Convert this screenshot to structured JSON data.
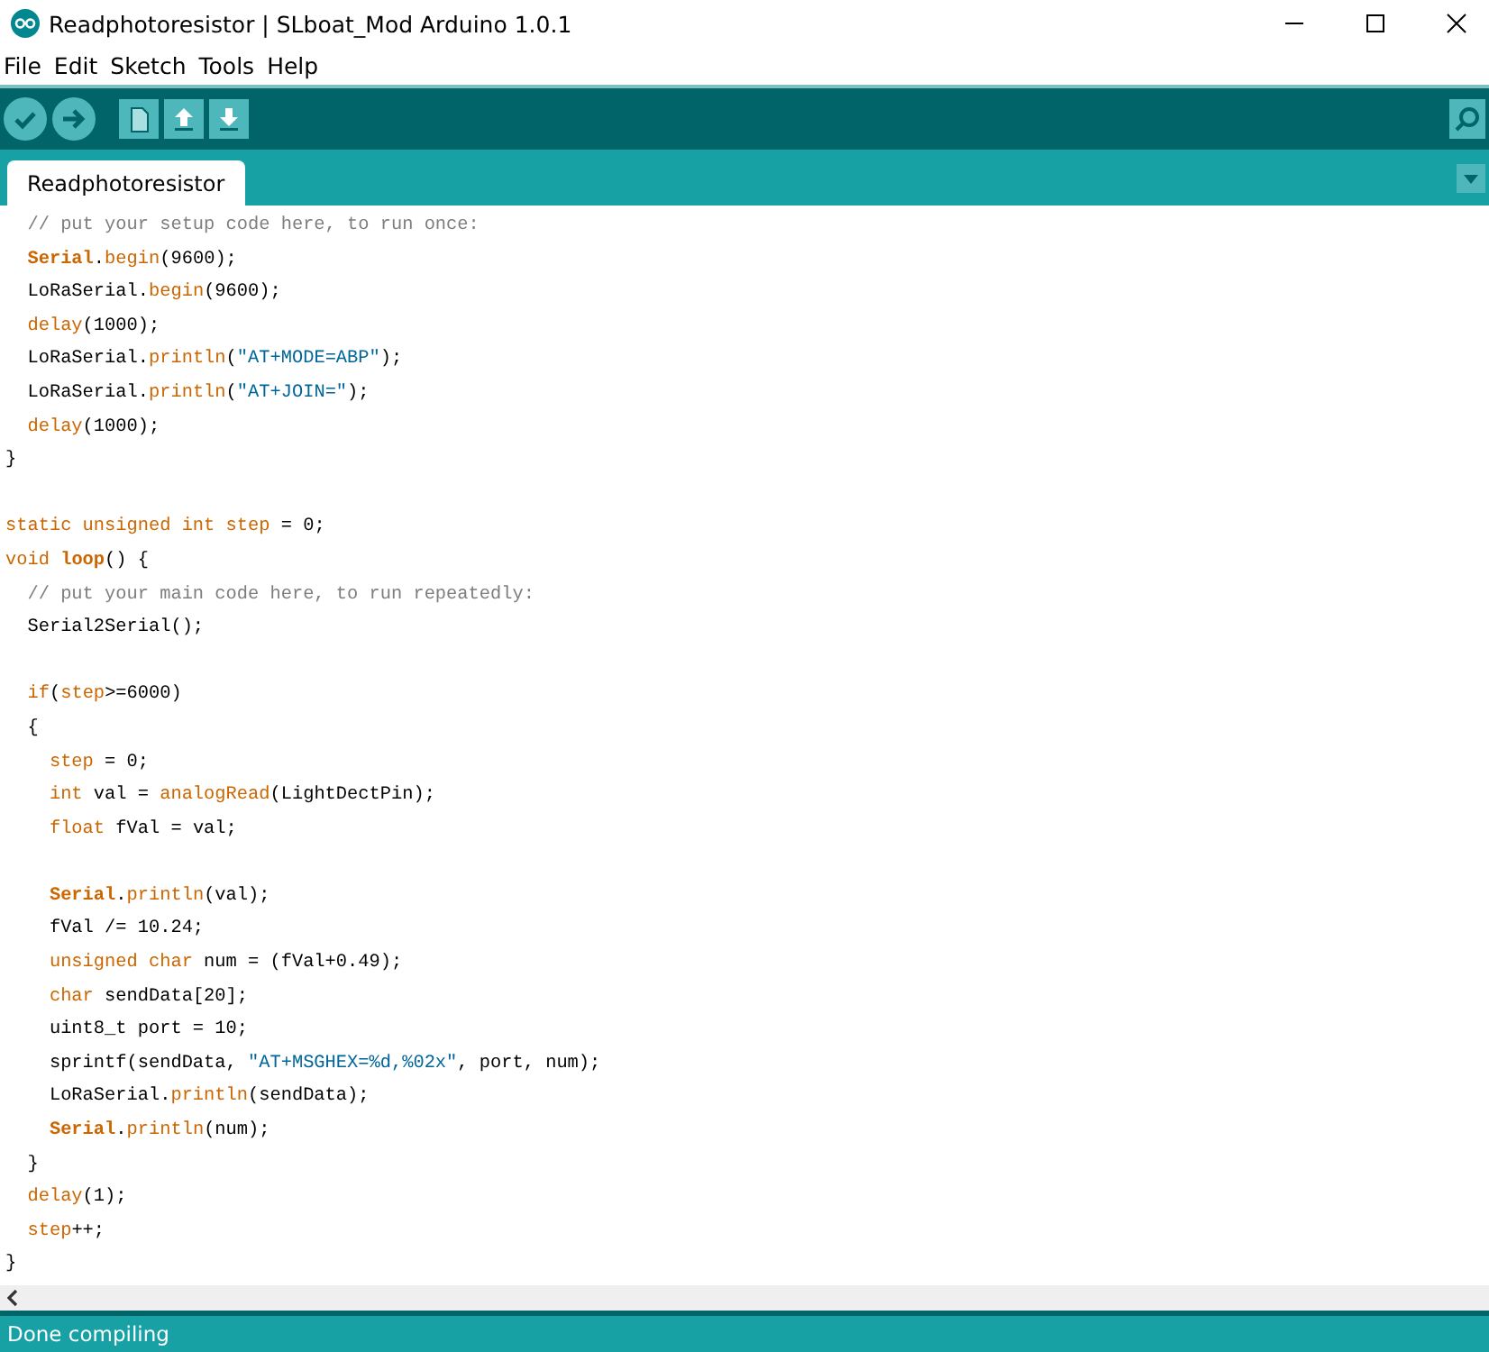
{
  "window": {
    "title": "Readphotoresistor | SLboat_Mod Arduino 1.0.1"
  },
  "menu": [
    "File",
    "Edit",
    "Sketch",
    "Tools",
    "Help"
  ],
  "toolbar": [
    {
      "kind": "verify"
    },
    {
      "kind": "upload"
    },
    {
      "kind": "new"
    },
    {
      "kind": "open"
    },
    {
      "kind": "save"
    }
  ],
  "tabs": [
    {
      "label": "Readphotoresistor",
      "selected": true
    }
  ],
  "code": [
    {
      "kind": "code",
      "tokens": [
        {
          "kind": "comment",
          "text": "  // put your setup code here, to run once:"
        }
      ]
    },
    {
      "kind": "code",
      "tokens": [
        {
          "kind": "class",
          "text": "  Serial"
        },
        {
          "kind": "plain",
          "text": "."
        },
        {
          "kind": "keyword",
          "text": "begin"
        },
        {
          "kind": "plain",
          "text": "(9600);"
        }
      ]
    },
    {
      "kind": "code",
      "tokens": [
        {
          "kind": "plain",
          "text": "  LoRaSerial."
        },
        {
          "kind": "keyword",
          "text": "begin"
        },
        {
          "kind": "plain",
          "text": "(9600);"
        }
      ]
    },
    {
      "kind": "code",
      "tokens": [
        {
          "kind": "keyword",
          "text": "  delay"
        },
        {
          "kind": "plain",
          "text": "(1000);"
        }
      ]
    },
    {
      "kind": "code",
      "tokens": [
        {
          "kind": "plain",
          "text": "  LoRaSerial."
        },
        {
          "kind": "keyword",
          "text": "println"
        },
        {
          "kind": "plain",
          "text": "("
        },
        {
          "kind": "string",
          "text": "\"AT+MODE=ABP\""
        },
        {
          "kind": "plain",
          "text": ");"
        }
      ]
    },
    {
      "kind": "code",
      "tokens": [
        {
          "kind": "plain",
          "text": "  LoRaSerial."
        },
        {
          "kind": "keyword",
          "text": "println"
        },
        {
          "kind": "plain",
          "text": "("
        },
        {
          "kind": "string",
          "text": "\"AT+JOIN=\""
        },
        {
          "kind": "plain",
          "text": ");"
        }
      ]
    },
    {
      "kind": "code",
      "tokens": [
        {
          "kind": "keyword",
          "text": "  delay"
        },
        {
          "kind": "plain",
          "text": "(1000);"
        }
      ]
    },
    {
      "kind": "code",
      "tokens": [
        {
          "kind": "plain",
          "text": "}"
        }
      ]
    },
    {
      "kind": "blank"
    },
    {
      "kind": "code",
      "tokens": [
        {
          "kind": "keyword",
          "text": "static unsigned int step"
        },
        {
          "kind": "plain",
          "text": " = 0;"
        }
      ]
    },
    {
      "kind": "code",
      "tokens": [
        {
          "kind": "keyword",
          "text": "void "
        },
        {
          "kind": "class",
          "text": "loop"
        },
        {
          "kind": "plain",
          "text": "() {"
        }
      ]
    },
    {
      "kind": "code",
      "tokens": [
        {
          "kind": "comment",
          "text": "  // put your main code here, to run repeatedly:"
        }
      ]
    },
    {
      "kind": "code",
      "tokens": [
        {
          "kind": "plain",
          "text": "  Serial2Serial();"
        }
      ]
    },
    {
      "kind": "blank"
    },
    {
      "kind": "code",
      "tokens": [
        {
          "kind": "keyword",
          "text": "  if"
        },
        {
          "kind": "plain",
          "text": "("
        },
        {
          "kind": "keyword",
          "text": "step"
        },
        {
          "kind": "plain",
          "text": ">=6000)"
        }
      ]
    },
    {
      "kind": "code",
      "tokens": [
        {
          "kind": "plain",
          "text": "  {"
        }
      ]
    },
    {
      "kind": "code",
      "tokens": [
        {
          "kind": "keyword",
          "text": "    step"
        },
        {
          "kind": "plain",
          "text": " = 0;"
        }
      ]
    },
    {
      "kind": "code",
      "tokens": [
        {
          "kind": "keyword",
          "text": "    int"
        },
        {
          "kind": "plain",
          "text": " val = "
        },
        {
          "kind": "keyword",
          "text": "analogRead"
        },
        {
          "kind": "plain",
          "text": "(LightDectPin);"
        }
      ]
    },
    {
      "kind": "code",
      "tokens": [
        {
          "kind": "keyword",
          "text": "    float"
        },
        {
          "kind": "plain",
          "text": " fVal = val;"
        }
      ]
    },
    {
      "kind": "blank"
    },
    {
      "kind": "code",
      "tokens": [
        {
          "kind": "class",
          "text": "    Serial"
        },
        {
          "kind": "plain",
          "text": "."
        },
        {
          "kind": "keyword",
          "text": "println"
        },
        {
          "kind": "plain",
          "text": "(val);"
        }
      ]
    },
    {
      "kind": "code",
      "tokens": [
        {
          "kind": "plain",
          "text": "    fVal /= 10.24;"
        }
      ]
    },
    {
      "kind": "code",
      "tokens": [
        {
          "kind": "keyword",
          "text": "    unsigned char"
        },
        {
          "kind": "plain",
          "text": " num = (fVal+0.49);"
        }
      ]
    },
    {
      "kind": "code",
      "tokens": [
        {
          "kind": "keyword",
          "text": "    char"
        },
        {
          "kind": "plain",
          "text": " sendData[20];"
        }
      ]
    },
    {
      "kind": "code",
      "tokens": [
        {
          "kind": "plain",
          "text": "    uint8_t port = 10;"
        }
      ]
    },
    {
      "kind": "code",
      "tokens": [
        {
          "kind": "plain",
          "text": "    sprintf(sendData, "
        },
        {
          "kind": "string",
          "text": "\"AT+MSGHEX=%d,%02x\""
        },
        {
          "kind": "plain",
          "text": ", port, num);"
        }
      ]
    },
    {
      "kind": "code",
      "tokens": [
        {
          "kind": "plain",
          "text": "    LoRaSerial."
        },
        {
          "kind": "keyword",
          "text": "println"
        },
        {
          "kind": "plain",
          "text": "(sendData);"
        }
      ]
    },
    {
      "kind": "code",
      "tokens": [
        {
          "kind": "class",
          "text": "    Serial"
        },
        {
          "kind": "plain",
          "text": "."
        },
        {
          "kind": "keyword",
          "text": "println"
        },
        {
          "kind": "plain",
          "text": "(num);"
        }
      ]
    },
    {
      "kind": "code",
      "tokens": [
        {
          "kind": "plain",
          "text": "  }"
        }
      ]
    },
    {
      "kind": "code",
      "tokens": [
        {
          "kind": "keyword",
          "text": "  delay"
        },
        {
          "kind": "plain",
          "text": "(1);"
        }
      ]
    },
    {
      "kind": "code",
      "tokens": [
        {
          "kind": "keyword",
          "text": "  step"
        },
        {
          "kind": "plain",
          "text": "++;"
        }
      ]
    },
    {
      "kind": "code",
      "tokens": [
        {
          "kind": "plain",
          "text": "}"
        }
      ]
    }
  ],
  "status_bar": {
    "text": "Done compiling"
  }
}
